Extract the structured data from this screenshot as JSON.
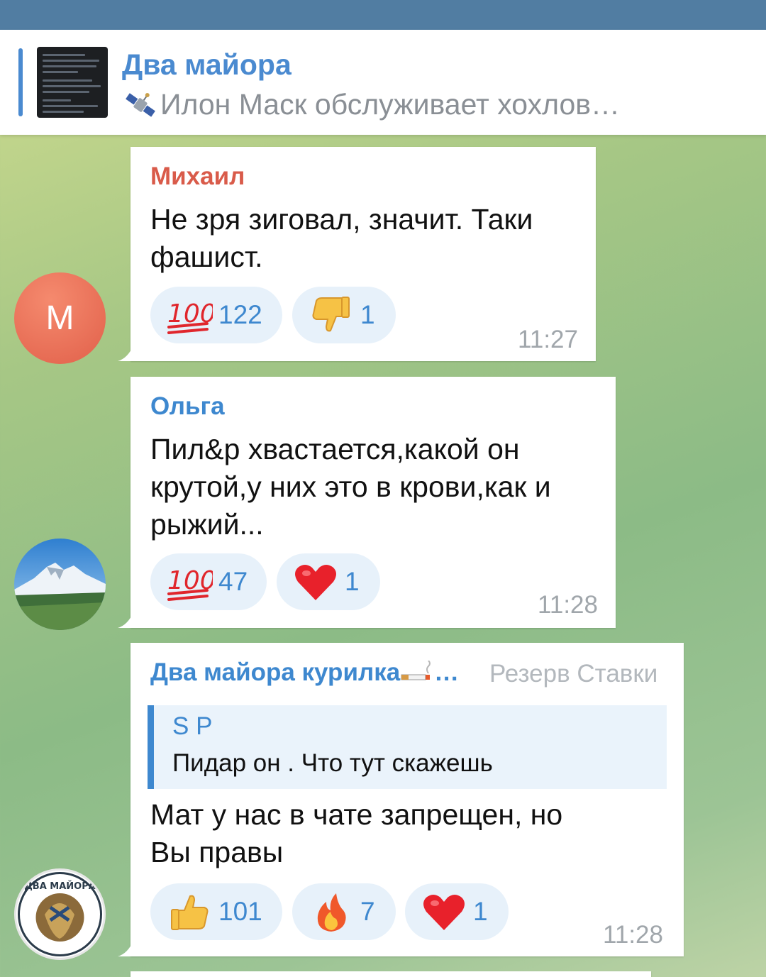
{
  "pinned": {
    "title": "Два майора",
    "subtitle": "Илон Маск обслуживает хохлов…",
    "icon": "satellite-icon",
    "accent": "#4a8ad0"
  },
  "messages": [
    {
      "avatar_letter": "М",
      "author": "Михаил",
      "author_color": "#d95b4a",
      "text_lines": [
        "Не зря зиговал, значит. Таки",
        "фашист."
      ],
      "reactions": [
        {
          "icon": "hundred-points-icon",
          "count": "122"
        },
        {
          "icon": "thumbs-down-icon",
          "count": "1"
        }
      ],
      "time": "11:27"
    },
    {
      "avatar": "mountain-avatar",
      "author": "Ольга",
      "author_color": "#3e88cf",
      "text_lines": [
        "Пил&р хвастается,какой он",
        "крутой,у них это в крови,как и",
        "рыжий..."
      ],
      "reactions": [
        {
          "icon": "hundred-points-icon",
          "count": "47"
        },
        {
          "icon": "red-heart-icon",
          "count": "1"
        }
      ],
      "time": "11:28"
    },
    {
      "avatar": "dva-mayora-logo",
      "avatar_text": "ДВА МАЙОРА",
      "author": "Два майора курилка",
      "author_suffix": "…",
      "author_color": "#3e88cf",
      "forward_label": "Резерв Ставки",
      "reply": {
        "name": "S P",
        "text": "Пидар он . Что тут скажешь"
      },
      "text_lines": [
        "Мат у нас в чате запрещен, но",
        "Вы правы"
      ],
      "reactions": [
        {
          "icon": "thumbs-up-icon",
          "count": "101"
        },
        {
          "icon": "fire-icon",
          "count": "7"
        },
        {
          "icon": "red-heart-icon",
          "count": "1"
        }
      ],
      "time": "11:28"
    }
  ]
}
